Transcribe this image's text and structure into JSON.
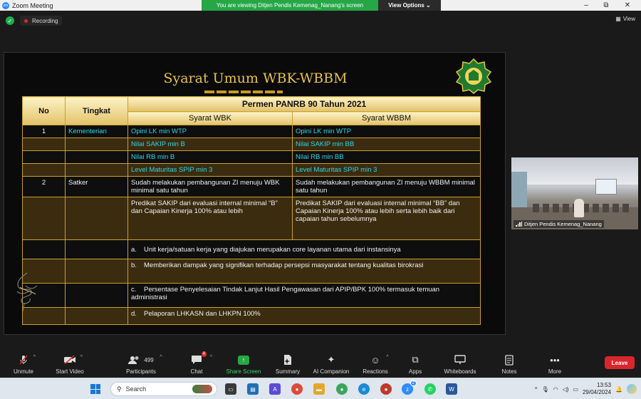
{
  "window": {
    "app_title": "Zoom Meeting",
    "viewing_banner": "You are viewing Ditjen Pendis Kemenag_Nanang's screen",
    "view_options": "View Options"
  },
  "status": {
    "recording": "Recording",
    "view": "View"
  },
  "slide": {
    "title": "Syarat Umum WBK-WBBM",
    "headers": {
      "no": "No",
      "tingkat": "Tingkat",
      "permen": "Permen PANRB 90 Tahun 2021",
      "wbk": "Syarat WBK",
      "wbbm": "Syarat WBBM"
    },
    "rows": [
      {
        "no": "1",
        "tingkat": "Kementerian",
        "wbk": "Opini LK min WTP",
        "wbbm": "Opini LK min WTP"
      },
      {
        "no": "",
        "tingkat": "",
        "wbk": "Nilai SAKIP min B",
        "wbbm": "Nilai SAKIP min BB"
      },
      {
        "no": "",
        "tingkat": "",
        "wbk": "Nilai RB min B",
        "wbbm": "Nilai RB min BB"
      },
      {
        "no": "",
        "tingkat": "",
        "wbk": "Level Maturitas SPIP min 3",
        "wbbm": "Level Maturitas SPIP min 3"
      },
      {
        "no": "2",
        "tingkat": "Satker",
        "wbk": "Sudah melakukan pembangunan ZI menuju WBK minimal satu tahun",
        "wbbm": "Sudah melakukan pembangunan ZI menuju WBBM minimal satu tahun"
      },
      {
        "no": "",
        "tingkat": "",
        "wbk": "Predikat SAKIP dari evaluasi internal minimal “B” dan Capaian Kinerja 100% atau lebih",
        "wbbm": "Predikat SAKIP dari evaluasi internal minimal “BB” dan Capaian Kinerja 100% atau lebih serta lebih baik dari capaian tahun sebelumnya"
      }
    ],
    "list_items": [
      {
        "letter": "a.",
        "text": "Unit kerja/satuan kerja yang diajukan merupakan core layanan utama dari instansinya"
      },
      {
        "letter": "b.",
        "text": "Memberikan dampak yang signifikan terhadap persepsi masyarakat tentang kualitas birokrasi"
      },
      {
        "letter": "c.",
        "text": "Persentase Penyelesaian Tindak Lanjut Hasil Pengawasan dari APIP/BPK 100% termasuk temuan administrasi"
      },
      {
        "letter": "d.",
        "text": "Pelaporan LHKASN dan LHKPN 100%"
      }
    ]
  },
  "camera": {
    "participant_name": "Ditjen Pendis Kemenag_Nanang"
  },
  "toolbar": {
    "unmute": "Unmute",
    "start_video": "Start Video",
    "participants": "Participants",
    "participants_count": "499",
    "chat": "Chat",
    "chat_badge": "4",
    "share_screen": "Share Screen",
    "summary": "Summary",
    "ai_companion": "AI Companion",
    "reactions": "Reactions",
    "apps": "Apps",
    "whiteboards": "Whiteboards",
    "notes": "Notes",
    "more": "More",
    "leave": "Leave"
  },
  "taskbar": {
    "search_placeholder": "Search",
    "time": "13:53",
    "date": "29/04/2024",
    "zoom_badge": "2"
  },
  "colors": {
    "title_gold": "#e8c24a",
    "cyan_text": "#2ed6e8",
    "green_banner": "#26a745",
    "leave_red": "#d9262c"
  }
}
